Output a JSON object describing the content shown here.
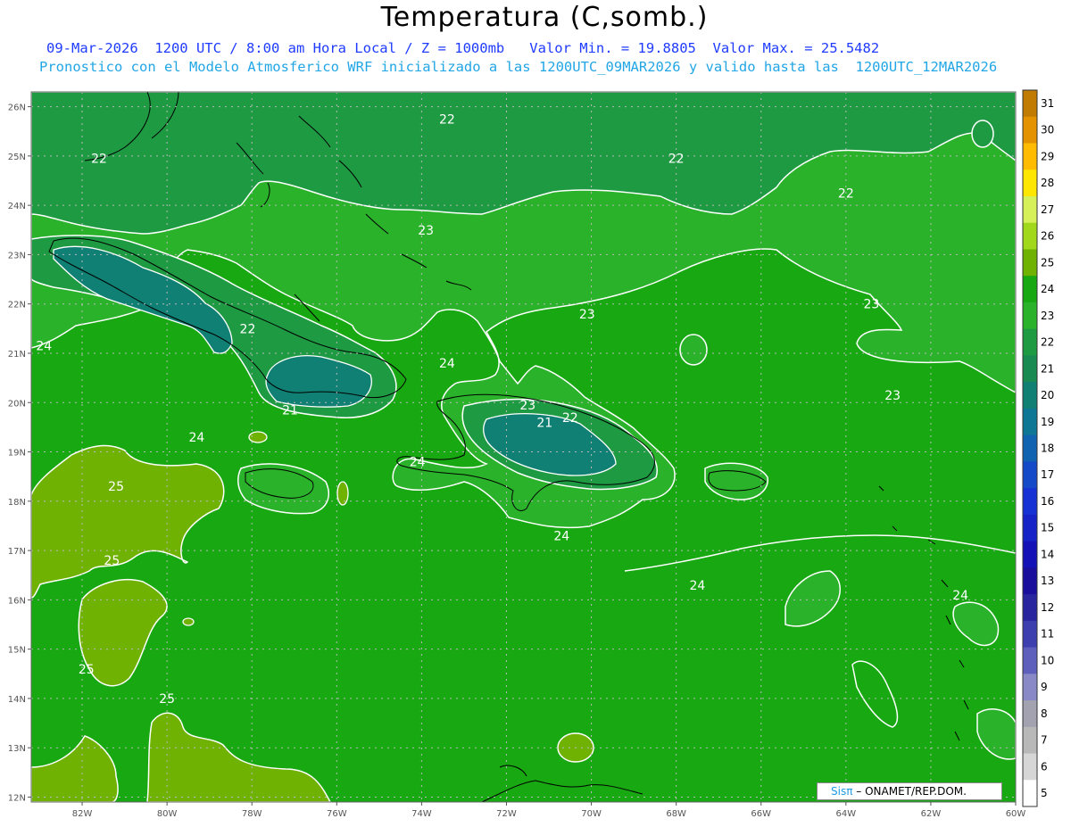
{
  "header": {
    "title": "Temperatura (C,somb.)",
    "line1": "09-Mar-2026  1200 UTC / 8:00 am Hora Local / Z = 1000mb   Valor Min. = 19.8805  Valor Max. = 25.5482",
    "line2": "Pronostico con el Modelo Atmosferico WRF inicializado a las 1200UTC_09MAR2026 y valido hasta las  1200UTC_12MAR2026"
  },
  "axes": {
    "lon_labels": [
      "82W",
      "80W",
      "78W",
      "76W",
      "74W",
      "72W",
      "70W",
      "68W",
      "66W",
      "64W",
      "62W",
      "60W"
    ],
    "lat_labels": [
      "26N",
      "25N",
      "24N",
      "23N",
      "22N",
      "21N",
      "20N",
      "19N",
      "18N",
      "17N",
      "16N",
      "15N",
      "14N",
      "13N",
      "12N"
    ]
  },
  "contour_labels": [
    {
      "text": "22",
      "lon": -73.4,
      "lat": 25.75
    },
    {
      "text": "22",
      "lon": -81.6,
      "lat": 24.95
    },
    {
      "text": "22",
      "lon": -68.0,
      "lat": 24.95
    },
    {
      "text": "22",
      "lon": -64.0,
      "lat": 24.25
    },
    {
      "text": "23",
      "lon": -73.9,
      "lat": 23.5
    },
    {
      "text": "23",
      "lon": -63.4,
      "lat": 22.0
    },
    {
      "text": "23",
      "lon": -70.1,
      "lat": 21.8
    },
    {
      "text": "22",
      "lon": -78.1,
      "lat": 21.5
    },
    {
      "text": "24",
      "lon": -82.9,
      "lat": 21.15
    },
    {
      "text": "24",
      "lon": -73.4,
      "lat": 20.8
    },
    {
      "text": "23",
      "lon": -62.9,
      "lat": 20.15
    },
    {
      "text": "21",
      "lon": -77.1,
      "lat": 19.85
    },
    {
      "text": "23",
      "lon": -71.5,
      "lat": 19.95
    },
    {
      "text": "21",
      "lon": -71.1,
      "lat": 19.6
    },
    {
      "text": "22",
      "lon": -70.5,
      "lat": 19.7
    },
    {
      "text": "24",
      "lon": -79.3,
      "lat": 19.3
    },
    {
      "text": "24",
      "lon": -74.1,
      "lat": 18.8
    },
    {
      "text": "25",
      "lon": -81.2,
      "lat": 18.3
    },
    {
      "text": "24",
      "lon": -70.7,
      "lat": 17.3
    },
    {
      "text": "25",
      "lon": -81.3,
      "lat": 16.8
    },
    {
      "text": "24",
      "lon": -67.5,
      "lat": 16.3
    },
    {
      "text": "24",
      "lon": -61.3,
      "lat": 16.1
    },
    {
      "text": "25",
      "lon": -81.9,
      "lat": 14.6
    },
    {
      "text": "25",
      "lon": -80.0,
      "lat": 14.0
    }
  ],
  "colorbar": {
    "labels": [
      "31",
      "30",
      "29",
      "28",
      "27",
      "26",
      "25",
      "24",
      "23",
      "22",
      "21",
      "20",
      "19",
      "18",
      "17",
      "16",
      "15",
      "14",
      "13",
      "12",
      "11",
      "10",
      "9",
      "8",
      "7",
      "6",
      "5"
    ],
    "colors": [
      "#c07b00",
      "#e49200",
      "#ffbb00",
      "#ffe600",
      "#d6f05a",
      "#a2d81c",
      "#70b202",
      "#18a812",
      "#2ab22a",
      "#1e9a42",
      "#188a52",
      "#0f8073",
      "#0e7795",
      "#0f63b0",
      "#1449c8",
      "#1732d4",
      "#1624c7",
      "#1412b6",
      "#1a0f9c",
      "#28259e",
      "#3d3fae",
      "#5e5fbc",
      "#8a89c8",
      "#a2a2b0",
      "#b8b8b8",
      "#d6d6d6",
      "#ffffff"
    ]
  },
  "credit": {
    "brand": "Sisπ",
    "text": "– ONAMET/REP.DOM."
  }
}
